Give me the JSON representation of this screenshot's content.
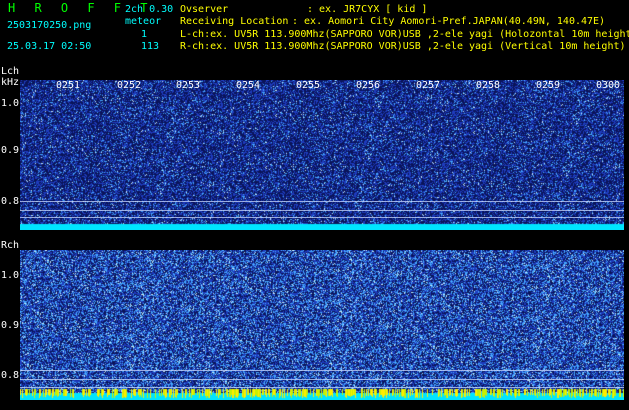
{
  "header": {
    "title": "H R O F F T",
    "mode": "2ch 0.30",
    "filename": "2503170250.png",
    "meteor_label": "meteor",
    "count_lch": "1",
    "count_rch": "113",
    "datetime": "25.03.17 02:50",
    "observer_label": "Ovserver",
    "observer_value": ": ex. JR7CYX [ kid ]",
    "location_label": "Receiving Location",
    "location_value": ": ex. Aomori City Aomori-Pref.JAPAN(40.49N, 140.47E)",
    "lch_info": "L-ch:ex. UV5R 113.900Mhz(SAPPORO VOR)USB ,2-ele yagi (Holozontal 10m height)",
    "rch_info": "R-ch:ex. UV5R 113.900Mhz(SAPPORO VOR)USB ,2-ele yagi (Vertical 10m height)"
  },
  "lch_panel": {
    "label": "Lch",
    "unit": "kHz",
    "y_ticks": [
      "1.0",
      "0.9",
      "0.8"
    ]
  },
  "rch_panel": {
    "label": "Rch",
    "y_ticks": [
      "1.0",
      "0.9",
      "0.8"
    ]
  },
  "time_ticks": [
    "0251",
    "0252",
    "0253",
    "0254",
    "0255",
    "0256",
    "0257",
    "0258",
    "0259",
    "0300"
  ],
  "colors": {
    "background": "#000000",
    "header_green": "#00ff00",
    "header_cyan": "#00ffff",
    "header_yellow": "#ffff00",
    "noise_base": "#1a2f9e",
    "noise_bright": "#3ad6ff",
    "band_cyan": "#00e5ff",
    "band_yellow": "#ffee00"
  }
}
